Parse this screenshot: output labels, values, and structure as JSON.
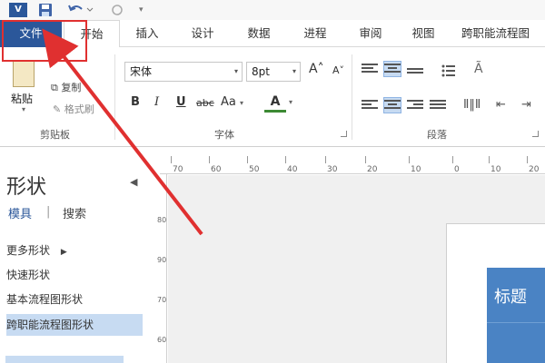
{
  "qat": {
    "app_logo": "V",
    "icons": [
      "visio-logo-icon",
      "save-icon",
      "undo-icon",
      "redo-icon",
      "customize-qat-icon"
    ],
    "more_glyph": "▾"
  },
  "tabs": [
    {
      "id": "file",
      "label": "文件"
    },
    {
      "id": "home",
      "label": "开始"
    },
    {
      "id": "insert",
      "label": "插入"
    },
    {
      "id": "design",
      "label": "设计"
    },
    {
      "id": "data",
      "label": "数据"
    },
    {
      "id": "process",
      "label": "进程"
    },
    {
      "id": "review",
      "label": "审阅"
    },
    {
      "id": "view",
      "label": "视图"
    },
    {
      "id": "crossfunc",
      "label": "跨职能流程图"
    }
  ],
  "ribbon": {
    "clipboard": {
      "group_label": "剪贴板",
      "paste_label": "粘贴",
      "copy_label": "复制",
      "format_painter_label": "格式刷"
    },
    "font": {
      "group_label": "字体",
      "font_name": "宋体",
      "font_size": "8pt",
      "grow_label": "A˄",
      "shrink_label": "A˅",
      "bold_label": "B",
      "italic_label": "I",
      "underline_label": "U",
      "strike_label": "abc",
      "case_label": "Aa",
      "font_color_label": "A",
      "font_color_hex": "#3c8a34"
    },
    "paragraph": {
      "group_label": "段落",
      "indent_label": "Ã",
      "columns_label": "Ⅱ‖Ⅱ",
      "dec_indent_label": "⇤",
      "inc_indent_label": "⇥"
    }
  },
  "shapes_panel": {
    "title": "形状",
    "stencils_tab": "模具",
    "search_tab": "搜索",
    "items": [
      {
        "label": "更多形状"
      },
      {
        "label": "快速形状"
      },
      {
        "label": "基本流程图形状"
      },
      {
        "label": "跨职能流程图形状"
      }
    ]
  },
  "ruler": {
    "ticks": [
      "70",
      "60",
      "50",
      "40",
      "30",
      "20",
      "10",
      "0",
      "10",
      "20"
    ],
    "vticks": [
      "80",
      "90",
      "70",
      "60"
    ]
  },
  "canvas": {
    "title_shape_text": "标题"
  },
  "colors": {
    "file_tab": "#2b579a",
    "highlight_box": "#e03030",
    "annotation_arrow": "#e03030",
    "selected": "#c7dbf2",
    "title_shape": "#4a83c4"
  }
}
